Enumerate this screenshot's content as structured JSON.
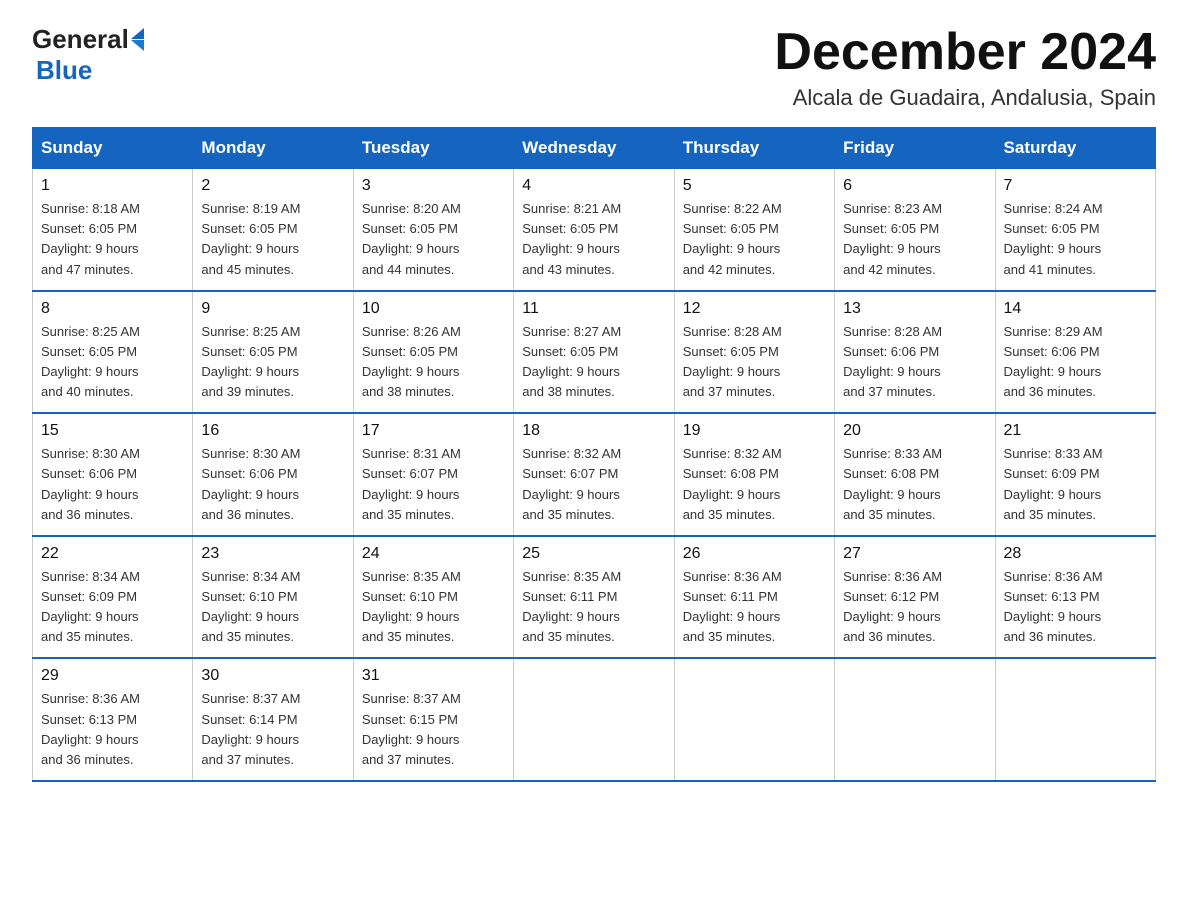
{
  "logo": {
    "general": "General",
    "blue": "Blue"
  },
  "header": {
    "month": "December 2024",
    "location": "Alcala de Guadaira, Andalusia, Spain"
  },
  "weekdays": [
    "Sunday",
    "Monday",
    "Tuesday",
    "Wednesday",
    "Thursday",
    "Friday",
    "Saturday"
  ],
  "weeks": [
    [
      {
        "day": "1",
        "sunrise": "8:18 AM",
        "sunset": "6:05 PM",
        "daylight": "9 hours and 47 minutes."
      },
      {
        "day": "2",
        "sunrise": "8:19 AM",
        "sunset": "6:05 PM",
        "daylight": "9 hours and 45 minutes."
      },
      {
        "day": "3",
        "sunrise": "8:20 AM",
        "sunset": "6:05 PM",
        "daylight": "9 hours and 44 minutes."
      },
      {
        "day": "4",
        "sunrise": "8:21 AM",
        "sunset": "6:05 PM",
        "daylight": "9 hours and 43 minutes."
      },
      {
        "day": "5",
        "sunrise": "8:22 AM",
        "sunset": "6:05 PM",
        "daylight": "9 hours and 42 minutes."
      },
      {
        "day": "6",
        "sunrise": "8:23 AM",
        "sunset": "6:05 PM",
        "daylight": "9 hours and 42 minutes."
      },
      {
        "day": "7",
        "sunrise": "8:24 AM",
        "sunset": "6:05 PM",
        "daylight": "9 hours and 41 minutes."
      }
    ],
    [
      {
        "day": "8",
        "sunrise": "8:25 AM",
        "sunset": "6:05 PM",
        "daylight": "9 hours and 40 minutes."
      },
      {
        "day": "9",
        "sunrise": "8:25 AM",
        "sunset": "6:05 PM",
        "daylight": "9 hours and 39 minutes."
      },
      {
        "day": "10",
        "sunrise": "8:26 AM",
        "sunset": "6:05 PM",
        "daylight": "9 hours and 38 minutes."
      },
      {
        "day": "11",
        "sunrise": "8:27 AM",
        "sunset": "6:05 PM",
        "daylight": "9 hours and 38 minutes."
      },
      {
        "day": "12",
        "sunrise": "8:28 AM",
        "sunset": "6:05 PM",
        "daylight": "9 hours and 37 minutes."
      },
      {
        "day": "13",
        "sunrise": "8:28 AM",
        "sunset": "6:06 PM",
        "daylight": "9 hours and 37 minutes."
      },
      {
        "day": "14",
        "sunrise": "8:29 AM",
        "sunset": "6:06 PM",
        "daylight": "9 hours and 36 minutes."
      }
    ],
    [
      {
        "day": "15",
        "sunrise": "8:30 AM",
        "sunset": "6:06 PM",
        "daylight": "9 hours and 36 minutes."
      },
      {
        "day": "16",
        "sunrise": "8:30 AM",
        "sunset": "6:06 PM",
        "daylight": "9 hours and 36 minutes."
      },
      {
        "day": "17",
        "sunrise": "8:31 AM",
        "sunset": "6:07 PM",
        "daylight": "9 hours and 35 minutes."
      },
      {
        "day": "18",
        "sunrise": "8:32 AM",
        "sunset": "6:07 PM",
        "daylight": "9 hours and 35 minutes."
      },
      {
        "day": "19",
        "sunrise": "8:32 AM",
        "sunset": "6:08 PM",
        "daylight": "9 hours and 35 minutes."
      },
      {
        "day": "20",
        "sunrise": "8:33 AM",
        "sunset": "6:08 PM",
        "daylight": "9 hours and 35 minutes."
      },
      {
        "day": "21",
        "sunrise": "8:33 AM",
        "sunset": "6:09 PM",
        "daylight": "9 hours and 35 minutes."
      }
    ],
    [
      {
        "day": "22",
        "sunrise": "8:34 AM",
        "sunset": "6:09 PM",
        "daylight": "9 hours and 35 minutes."
      },
      {
        "day": "23",
        "sunrise": "8:34 AM",
        "sunset": "6:10 PM",
        "daylight": "9 hours and 35 minutes."
      },
      {
        "day": "24",
        "sunrise": "8:35 AM",
        "sunset": "6:10 PM",
        "daylight": "9 hours and 35 minutes."
      },
      {
        "day": "25",
        "sunrise": "8:35 AM",
        "sunset": "6:11 PM",
        "daylight": "9 hours and 35 minutes."
      },
      {
        "day": "26",
        "sunrise": "8:36 AM",
        "sunset": "6:11 PM",
        "daylight": "9 hours and 35 minutes."
      },
      {
        "day": "27",
        "sunrise": "8:36 AM",
        "sunset": "6:12 PM",
        "daylight": "9 hours and 36 minutes."
      },
      {
        "day": "28",
        "sunrise": "8:36 AM",
        "sunset": "6:13 PM",
        "daylight": "9 hours and 36 minutes."
      }
    ],
    [
      {
        "day": "29",
        "sunrise": "8:36 AM",
        "sunset": "6:13 PM",
        "daylight": "9 hours and 36 minutes."
      },
      {
        "day": "30",
        "sunrise": "8:37 AM",
        "sunset": "6:14 PM",
        "daylight": "9 hours and 37 minutes."
      },
      {
        "day": "31",
        "sunrise": "8:37 AM",
        "sunset": "6:15 PM",
        "daylight": "9 hours and 37 minutes."
      },
      null,
      null,
      null,
      null
    ]
  ],
  "labels": {
    "sunrise": "Sunrise:",
    "sunset": "Sunset:",
    "daylight": "Daylight:"
  }
}
